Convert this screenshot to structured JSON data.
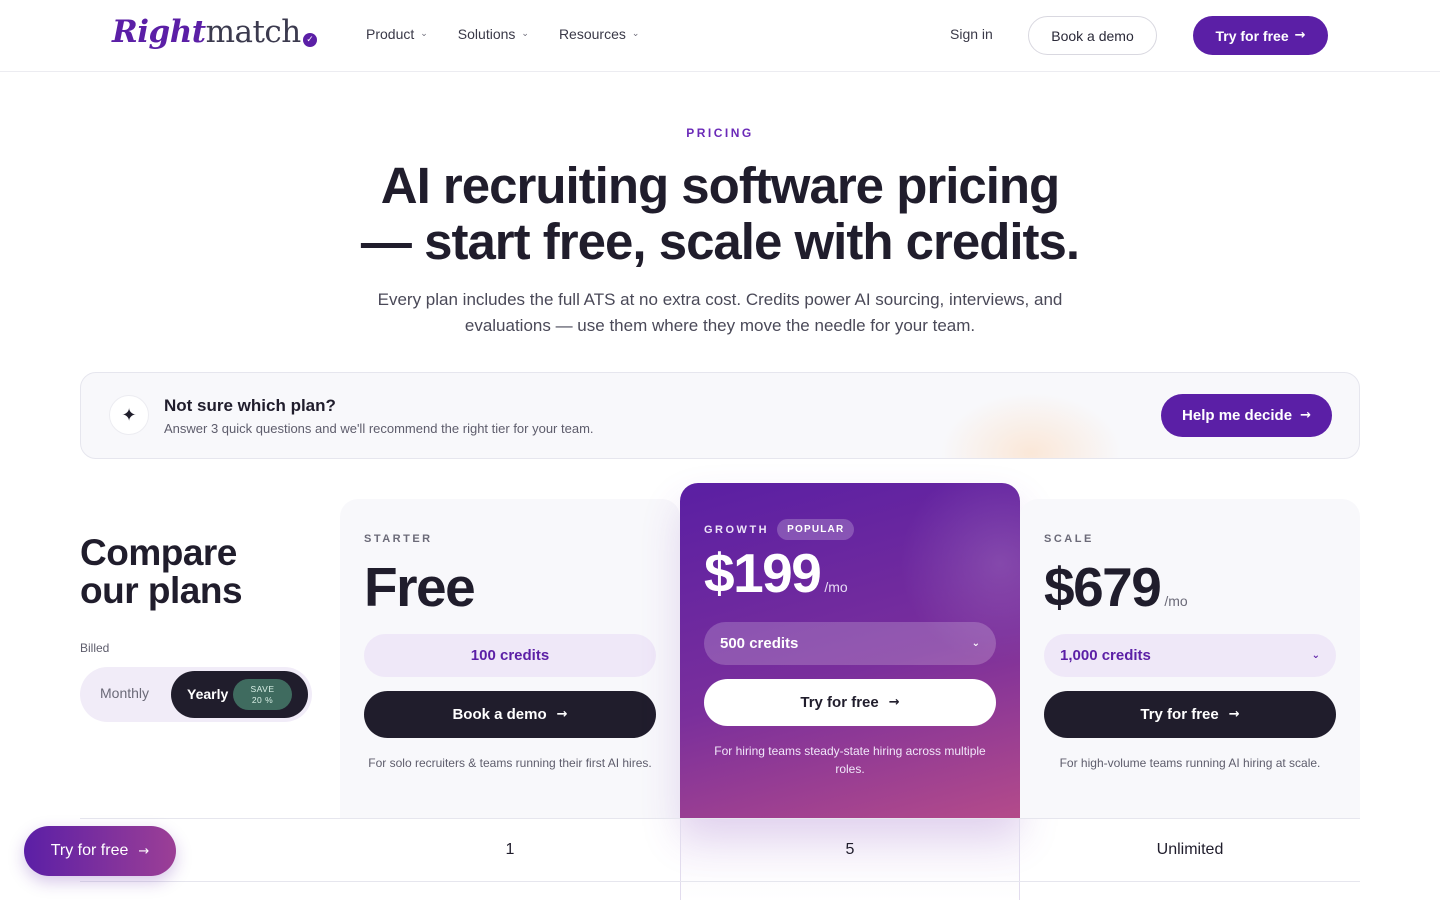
{
  "brand": {
    "logo_part1": "Right",
    "logo_part2": "match",
    "logo_badge": "✓"
  },
  "nav": {
    "items": [
      {
        "label": "Product"
      },
      {
        "label": "Solutions"
      },
      {
        "label": "Resources"
      }
    ],
    "sign_in": "Sign in",
    "book_demo": "Book a demo",
    "try_free": "Try for free"
  },
  "hero": {
    "eyebrow": "PRICING",
    "title_line1": "AI recruiting software pricing",
    "title_line2": "— start free, scale with credits.",
    "subtitle": "Every plan includes the full ATS at no extra cost. Credits power AI sourcing, interviews, and evaluations — use them where they move the needle for your team."
  },
  "decide": {
    "icon": "✦",
    "title": "Not sure which plan?",
    "subtitle": "Answer 3 quick questions and we'll recommend the right tier for your team.",
    "button": "Help me decide"
  },
  "compare": {
    "title_line1": "Compare",
    "title_line2": "our plans",
    "billed_label": "Billed",
    "monthly": "Monthly",
    "yearly": "Yearly",
    "save_line1": "SAVE",
    "save_line2": "20 %"
  },
  "plans": [
    {
      "name": "STARTER",
      "price": "Free",
      "per": "",
      "credits": "100 credits",
      "button": "Book a demo",
      "description": "For solo recruiters & teams running their first AI hires."
    },
    {
      "name": "GROWTH",
      "badge": "POPULAR",
      "price": "$199",
      "per": "/mo",
      "credits": "500 credits",
      "button": "Try for free",
      "description": "For hiring teams steady-state hiring across multiple roles."
    },
    {
      "name": "SCALE",
      "price": "$679",
      "per": "/mo",
      "credits": "1,000 credits",
      "button": "Try for free",
      "description": "For high-volume teams running AI hiring at scale."
    }
  ],
  "table_row": {
    "starter": "1",
    "growth": "5",
    "scale": "Unlimited"
  },
  "floating": {
    "label": "Try for free"
  },
  "colors": {
    "brand": "#5b1fa6",
    "dark": "#201d2c",
    "save_badge": "#3f6b5f"
  },
  "icons": {
    "chevron": "chevron-down-icon",
    "arrow": "arrow-right-icon",
    "sparkle": "sparkle-icon"
  }
}
